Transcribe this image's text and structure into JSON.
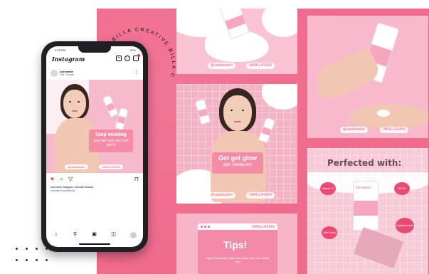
{
  "brand": {
    "curved_text": "BILLA CREATIVE BILLA CREA"
  },
  "phone": {
    "status_time": "9:25 PM",
    "status_battery": "87%",
    "app_title": "Instagram",
    "username": "username",
    "location": "City, Country",
    "caption": "username Instagram Carousel Mockup",
    "hashtags": "#Vanilla #SocialMedia",
    "post": {
      "headline": "Stop wishing",
      "subline": "you had your skin and get it!",
      "pill_left": "@vanillasskin",
      "pill_right": "VANILLASKIN"
    },
    "icons": {
      "add": "plus-square-icon",
      "heart": "heart-icon",
      "messenger": "messenger-icon"
    }
  },
  "tiles": {
    "cream_top": {
      "pill": "@vanillasskin",
      "word": "VANILLASKIN"
    },
    "glow": {
      "headline": "Get get glow",
      "subline": "with Vanillaskin",
      "pill": "@vanillasskin",
      "word": "VANILLASKIN"
    },
    "hand": {
      "pill": "@vanillasskin",
      "word": "VANILLASKIN"
    },
    "tips": {
      "title": "Tips!",
      "body": "Jaga kebersihan wajah dan pakai skin care setiap hari",
      "label": "VANILLASKIN"
    },
    "perfected": {
      "title": "Perfected with:",
      "tube_label": "Vanillaskin",
      "blobs": [
        "Vitamin C",
        "Vit B3",
        "Aloe Vera",
        "Hyaluronic Acid"
      ]
    }
  },
  "colors": {
    "canvas": "#f06a8c",
    "tile": "#f7bfd0",
    "accent": "#e94b74"
  }
}
